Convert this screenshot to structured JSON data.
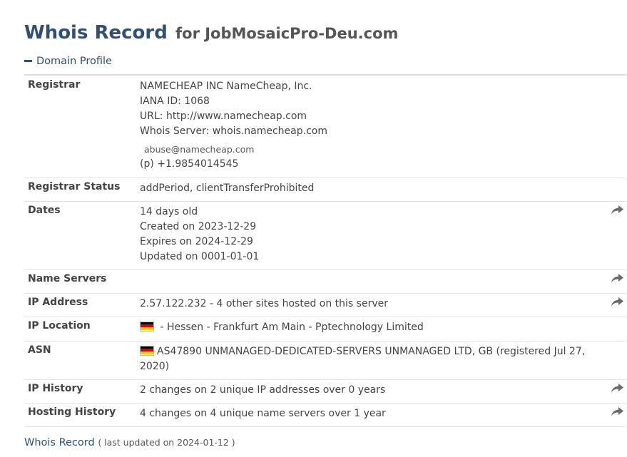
{
  "header": {
    "title_main": "Whois Record",
    "title_for": "for JobMosaicPro-Deu.com"
  },
  "section": {
    "label": "Domain Profile",
    "icon": "minus-icon"
  },
  "rows": {
    "registrar": {
      "label": "Registrar",
      "line1": "NAMECHEAP INC NameCheap, Inc.",
      "line2": "IANA ID: 1068",
      "line3": "URL: http://www.namecheap.com",
      "line4": "Whois Server: whois.namecheap.com",
      "email": "abuse@namecheap.com",
      "phone": "(p)  +1.9854014545"
    },
    "status": {
      "label": "Registrar Status",
      "value": "addPeriod, clientTransferProhibited"
    },
    "dates": {
      "label": "Dates",
      "line1": "14 days old",
      "line2": "Created on 2023-12-29",
      "line3": "Expires on 2024-12-29",
      "line4": "Updated on 0001-01-01"
    },
    "nameservers": {
      "label": "Name Servers",
      "value": ""
    },
    "ip": {
      "label": "IP Address",
      "value": "2.57.122.232 - 4 other sites hosted on this server"
    },
    "iplocation": {
      "label": "IP Location",
      "value": " - Hessen - Frankfurt Am Main - Pptechnology Limited"
    },
    "asn": {
      "label": "ASN",
      "value": "AS47890 UNMANAGED-DEDICATED-SERVERS UNMANAGED LTD, GB (registered Jul 27, 2020)"
    },
    "iphistory": {
      "label": "IP History",
      "value": "2 changes on 2 unique IP addresses over 0 years"
    },
    "hosting": {
      "label": "Hosting History",
      "value": "4 changes on 4 unique name servers over 1 year"
    }
  },
  "footer": {
    "link": "Whois Record",
    "note": "( last updated on 2024-01-12 )"
  },
  "colors": {
    "accent": "#2f4f73",
    "flag_black": "#000000",
    "flag_red": "#dd0000",
    "flag_gold": "#ffce00"
  },
  "icons": {
    "share": "share-arrow-icon",
    "flag": "germany-flag-icon"
  }
}
